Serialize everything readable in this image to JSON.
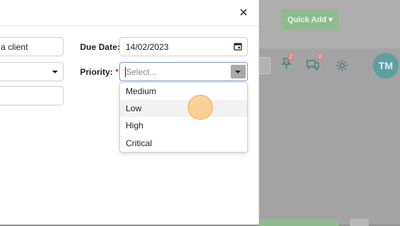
{
  "background": {
    "quick_add_label": "Quick Add ▾",
    "notification_badge_1": "2",
    "notification_badge_2": "0",
    "avatar_initials": "TM"
  },
  "modal": {
    "close_icon": "×",
    "client_field": {
      "value": "a client"
    },
    "due_date": {
      "label": "Due Date:",
      "value": "14/02/2023",
      "icon": "calendar-icon"
    },
    "priority": {
      "label": "Priority:",
      "required_mark": "*",
      "placeholder": "Select...",
      "options": [
        "Medium",
        "Low",
        "High",
        "Critical"
      ],
      "hovered_option": "Low"
    }
  },
  "colors": {
    "accent_green": "#8fbc8f",
    "focus_border": "#7a9bd0",
    "hover_row": "#f2f2f2"
  }
}
